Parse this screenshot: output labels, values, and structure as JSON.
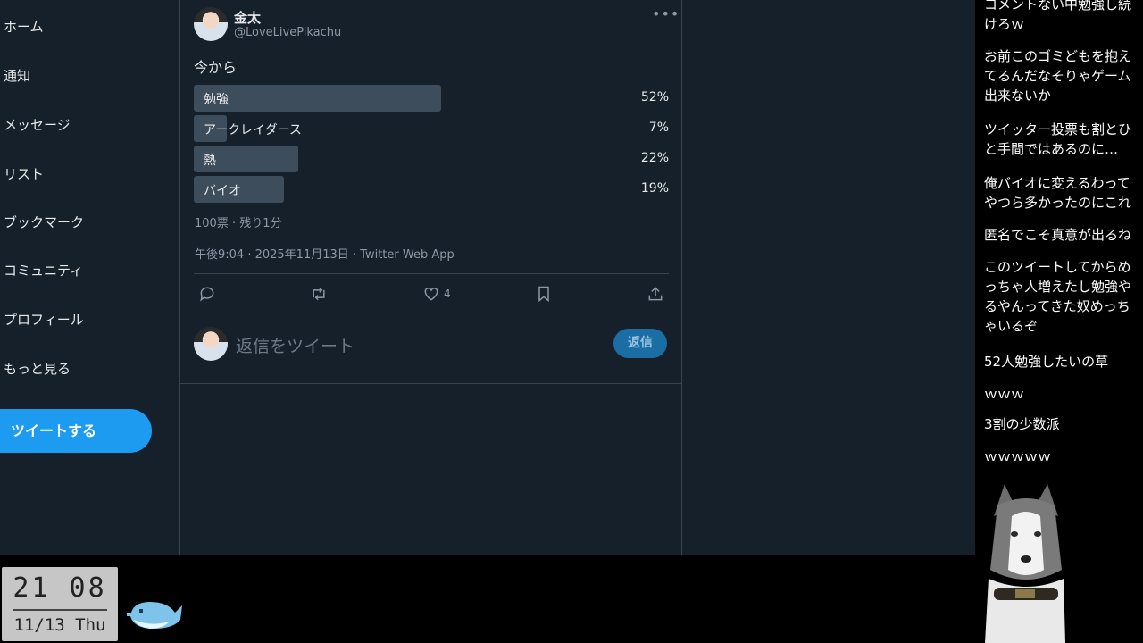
{
  "sidebar": {
    "items": [
      {
        "label": "ホーム"
      },
      {
        "label": "通知"
      },
      {
        "label": "メッセージ"
      },
      {
        "label": "リスト"
      },
      {
        "label": "ブックマーク"
      },
      {
        "label": "コミュニティ"
      },
      {
        "label": "プロフィール"
      },
      {
        "label": "もっと見る"
      }
    ],
    "tweet_button": "ツイートする"
  },
  "tweet": {
    "author_name": "金太",
    "author_handle": "@LoveLivePikachu",
    "more_icon": "more-dots-icon",
    "text": "今から",
    "poll": {
      "options": [
        {
          "label": "勉強",
          "percent_text": "52%",
          "percent": 52
        },
        {
          "label": "アークレイダース",
          "percent_text": "7%",
          "percent": 7
        },
        {
          "label": "熱",
          "percent_text": "22%",
          "percent": 22
        },
        {
          "label": "バイオ",
          "percent_text": "19%",
          "percent": 19
        }
      ],
      "meta": "100票 · 残り1分"
    },
    "timestamp": "午後9:04 · 2025年11月13日 · Twitter Web App",
    "actions": {
      "reply_icon": "reply-icon",
      "retweet_icon": "retweet-icon",
      "like_icon": "heart-icon",
      "like_count": "4",
      "bookmark_icon": "bookmark-icon",
      "share_icon": "share-icon"
    },
    "reply": {
      "placeholder": "返信をツイート",
      "button": "返信"
    }
  },
  "comments": [
    "コメントない中勉強し続けろｗ",
    "お前このゴミどもを抱えてるんだなそりゃゲーム出来ないか",
    "ツイッター投票も割とひと手間ではあるのに…",
    "俺バイオに変えるわってやつら多かったのにこれ",
    "匿名でこそ真意が出るね",
    "このツイートしてからめっちゃ人増えたし勉強やるやんってきた奴めっちゃいるぞ",
    "52人勉強したいの草",
    "ｗｗｗ",
    "3割の少数派",
    "ｗｗｗｗｗ"
  ],
  "clock": {
    "time": "21 08",
    "date": "11/13 Thu"
  },
  "colors": {
    "background": "#15202b",
    "accent": "#1d9bf0",
    "poll_bar": "#3d4d5c",
    "border": "#38444d",
    "muted_text": "#8b98a5"
  }
}
